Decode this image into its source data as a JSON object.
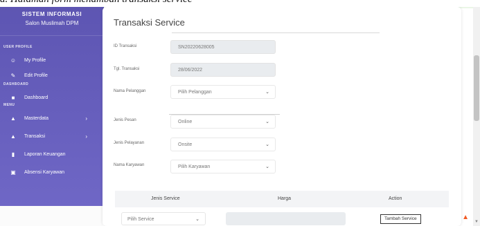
{
  "caption": "a. Halaman form menambah transaksi service",
  "sidebar": {
    "brand_line1": "SISTEM INFORMASI",
    "brand_line2": "Salon Muslimah DPM",
    "sections": {
      "user_profile": "USER PROFILE",
      "dashboard": "DASHBOARD",
      "menu": "MENU"
    },
    "items": [
      {
        "label": "My Profile",
        "icon": "user-icon"
      },
      {
        "label": "Edit Profile",
        "icon": "user-edit-icon"
      },
      {
        "label": "Dashboard",
        "icon": "dashboard-icon"
      },
      {
        "label": "Masterdata",
        "icon": "triangle-icon",
        "chevron": "›"
      },
      {
        "label": "Transaksi",
        "icon": "triangle-icon",
        "chevron": "›"
      },
      {
        "label": "Laporan Keuangan",
        "icon": "document-icon"
      },
      {
        "label": "Absensi Karyawan",
        "icon": "calendar-icon"
      }
    ]
  },
  "form": {
    "title": "Transaksi Service",
    "id_label": "ID Transaksi",
    "id_value": "SN20220628005",
    "date_label": "Tgl. Transaksi",
    "date_value": "28/06/2022",
    "customer_label": "Nama Pelanggan",
    "customer_value": "Pilih Pelanggan",
    "order_label": "Jenis Pesan",
    "order_value": "Online",
    "service_type_label": "Jenis Pelayanan",
    "service_type_value": "Onsite",
    "employee_label": "Nama Karyawan",
    "employee_value": "Pilih Karyawan"
  },
  "table": {
    "headers": [
      "Jenis Service",
      "Harga",
      "Action"
    ],
    "service_select_value": "Pilih Service",
    "add_button": "Tambah Service"
  },
  "colors": {
    "sidebar": "#6159b8",
    "accent_fire": "#f15a24"
  }
}
